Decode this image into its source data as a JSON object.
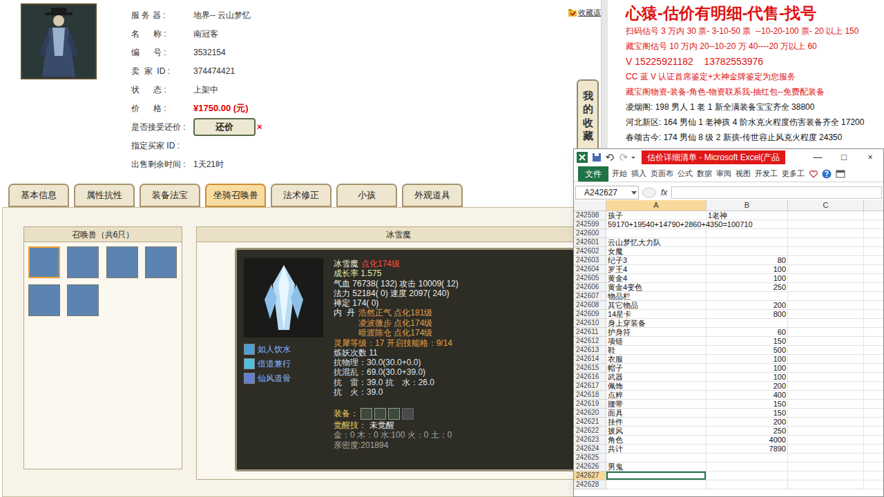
{
  "listing": {
    "favorite_link": "收藏该",
    "side_tab": "我的收藏",
    "fields": [
      {
        "kind": "text",
        "label": "服 务 器 :",
        "value": "地界-- 云山梦忆"
      },
      {
        "kind": "text",
        "label": "名      称 :",
        "value": "南冠客"
      },
      {
        "kind": "text",
        "label": "编      号 :",
        "value": "3532154"
      },
      {
        "kind": "text",
        "label": "卖  家  ID :",
        "value": "374474421"
      },
      {
        "kind": "text",
        "label": "状      态 :",
        "value": "上架中"
      },
      {
        "kind": "price",
        "label": "价      格 :",
        "value": "¥1750.00 (元)"
      },
      {
        "kind": "button",
        "label": "是否接受还价 :",
        "value": "还价",
        "mark": "×"
      },
      {
        "kind": "label",
        "label": "指定买家 ID :"
      },
      {
        "kind": "text",
        "label": "出售剩余时间 :",
        "value": "1天21时"
      }
    ]
  },
  "tabs": [
    {
      "label": "基本信息",
      "selected": false
    },
    {
      "label": "属性抗性",
      "selected": false
    },
    {
      "label": "装备法宝",
      "selected": false
    },
    {
      "label": "坐骑召唤兽",
      "selected": true
    },
    {
      "label": "法术修正",
      "selected": false
    },
    {
      "label": "小孩",
      "selected": false
    },
    {
      "label": "外观道具",
      "selected": false
    }
  ],
  "pets": {
    "title": "召唤兽（共6只）",
    "items": [
      {
        "selected": true
      },
      {
        "selected": false
      },
      {
        "selected": false
      },
      {
        "selected": false
      },
      {
        "selected": false
      },
      {
        "selected": false
      }
    ]
  },
  "pet_detail": {
    "header": "冰雪魔",
    "skills": [
      "如人饮水",
      "倍道兼行",
      "仙风道骨"
    ],
    "lines": [
      [
        {
          "text": "冰雪魔",
          "color": "#f2f2d8"
        },
        {
          "text": "点化174级",
          "color": "#ff5040"
        }
      ],
      [
        {
          "text": "成长率 1.575",
          "color": "#e6eeb0"
        }
      ],
      [
        {
          "text": "气血 76738( 132) 攻击 10009( 12)",
          "color": "#eeeeee"
        }
      ],
      [
        {
          "text": "法力 52184( 0) 速度 2097( 240)",
          "color": "#eeeeee"
        }
      ],
      [
        {
          "text": "禅定 174( 0)",
          "color": "#eeeeee"
        }
      ]
    ],
    "neidan": {
      "label": "内  丹",
      "items": [
        "浩然正气 点化181级",
        "凌波微步 点化174级",
        "暗渡陈仓 点化174级"
      ]
    },
    "lines2": [
      [
        {
          "text": "灵犀等级：17 开启技能格：9/14",
          "color": "#f0a040"
        }
      ],
      [
        {
          "text": "炼妖次数 11",
          "color": "#dde6f0"
        }
      ],
      [
        {
          "text": "抗物理：30.0(30.0+0.0)",
          "color": "#dde6f0"
        }
      ],
      [
        {
          "text": "抗混乱：69.0(30.0+39.0)",
          "color": "#dde6f0"
        }
      ],
      [
        {
          "text": "抗　雷：39.0 抗　水：26.0",
          "color": "#dde6f0"
        }
      ],
      [
        {
          "text": "抗　火：39.0",
          "color": "#dde6f0"
        }
      ]
    ],
    "equip_label": "装备：",
    "equip_slots": [
      {
        "filled": true
      },
      {
        "filled": true
      },
      {
        "filled": true
      },
      {
        "filled": false
      }
    ],
    "awaken": {
      "label": "觉醒技：",
      "value": "未觉醒"
    },
    "lines3": [
      "金：0 木：0 水:100 火：0 土：0",
      "亲密度:201894"
    ]
  },
  "ad": [
    {
      "kind": "title",
      "text": "心猿-估价有明细-代售-找号",
      "color": "#e01010"
    },
    {
      "kind": "line",
      "text": "扫码估号 3 万内 30 票- 3-10-50 票  --10-20-100 票- 20 以上 150",
      "color": "#e01010"
    },
    {
      "kind": "line",
      "text": "藏宝阁估号 10 万内 20--10-20 万 40----20 万以上 60",
      "color": "#e01010"
    },
    {
      "kind": "phone",
      "text": "V 15225921182    13782553976",
      "color": "#e01010"
    },
    {
      "kind": "line",
      "text": "CC 蓝 V 认证首席鉴定+大神金牌鉴定为您服务",
      "color": "#e01010"
    },
    {
      "kind": "line",
      "text": "藏宝阁物资-装备-角色-物资联系我-抽红包--免费配装备",
      "color": "#e01010"
    },
    {
      "kind": "line",
      "text": "凌烟阁: 198 男人 1 老 1 新全满装备宝宝齐全 38800",
      "color": "#111111"
    },
    {
      "kind": "line",
      "text": "河北新区: 164 男仙 1 老神孩 4 阶水克火程度伤害装备齐全 17200",
      "color": "#111111"
    },
    {
      "kind": "line",
      "text": "春颂古今: 174 男仙 8 级 2 新孩-传世容止风克火程度 24350",
      "color": "#111111"
    }
  ],
  "excel": {
    "title": "估价详细清单 - Microsoft Excel(产品",
    "window_buttons": [
      "—",
      "□",
      "×"
    ],
    "ribbon_tabs": [
      {
        "label": "文件",
        "kind": "file"
      },
      {
        "label": "开始",
        "kind": "tab"
      },
      {
        "label": "插入",
        "kind": "tab"
      },
      {
        "label": "页面布",
        "kind": "tab"
      },
      {
        "label": "公式",
        "kind": "tab"
      },
      {
        "label": "数据",
        "kind": "tab"
      },
      {
        "label": "审阅",
        "kind": "tab"
      },
      {
        "label": "视图",
        "kind": "tab"
      },
      {
        "label": "开发工",
        "kind": "tab"
      },
      {
        "label": "更多工",
        "kind": "tab"
      }
    ],
    "name_box": "A242627",
    "fx": "fx",
    "columns": [
      {
        "label": "A",
        "selected": true
      },
      {
        "label": "B",
        "selected": false
      },
      {
        "label": "C",
        "selected": false
      }
    ],
    "rows": [
      {
        "n": "242598",
        "a": "孩子",
        "b": "1老神",
        "selected": false
      },
      {
        "n": "242599",
        "a": "59170+19540+14790+2860+4350=100710",
        "b": "",
        "selected": false
      },
      {
        "n": "242600",
        "a": "",
        "b": "",
        "selected": false
      },
      {
        "n": "242601",
        "a": "云山梦忆大力队",
        "b": "",
        "selected": false
      },
      {
        "n": "242602",
        "a": "女魔",
        "b": "",
        "selected": false
      },
      {
        "n": "242603",
        "a": "纪子3",
        "b": "80",
        "selected": false
      },
      {
        "n": "242604",
        "a": "罗王4",
        "b": "100",
        "selected": false
      },
      {
        "n": "242605",
        "a": "黄金4",
        "b": "100",
        "selected": false
      },
      {
        "n": "242606",
        "a": "黄金4变色",
        "b": "250",
        "selected": false
      },
      {
        "n": "242607",
        "a": "物品栏",
        "b": "",
        "selected": false
      },
      {
        "n": "242608",
        "a": "其它物品",
        "b": "200",
        "selected": false
      },
      {
        "n": "242609",
        "a": "14星卡",
        "b": "800",
        "selected": false
      },
      {
        "n": "242610",
        "a": "身上穿装备",
        "b": "",
        "selected": false
      },
      {
        "n": "242611",
        "a": "护身符",
        "b": "60",
        "selected": false
      },
      {
        "n": "242612",
        "a": "项链",
        "b": "150",
        "selected": false
      },
      {
        "n": "242613",
        "a": "鞋",
        "b": "500",
        "selected": false
      },
      {
        "n": "242614",
        "a": "衣服",
        "b": "100",
        "selected": false
      },
      {
        "n": "242615",
        "a": "帽子",
        "b": "100",
        "selected": false
      },
      {
        "n": "242616",
        "a": "武器",
        "b": "100",
        "selected": false
      },
      {
        "n": "242617",
        "a": "佩饰",
        "b": "200",
        "selected": false
      },
      {
        "n": "242618",
        "a": "点粹",
        "b": "400",
        "selected": false
      },
      {
        "n": "242619",
        "a": "腰带",
        "b": "150",
        "selected": false
      },
      {
        "n": "242620",
        "a": "面具",
        "b": "150",
        "selected": false
      },
      {
        "n": "242621",
        "a": "挂件",
        "b": "200",
        "selected": false
      },
      {
        "n": "242622",
        "a": "披风",
        "b": "250",
        "selected": false
      },
      {
        "n": "242623",
        "a": "角色",
        "b": "4000",
        "selected": false
      },
      {
        "n": "242624",
        "a": "共计",
        "b": "7890",
        "selected": false
      },
      {
        "n": "242625",
        "a": "",
        "b": "",
        "selected": false
      },
      {
        "n": "242626",
        "a": "男鬼",
        "b": "",
        "selected": false
      },
      {
        "n": "242627",
        "a": "",
        "b": "",
        "selected": true
      },
      {
        "n": "242628",
        "a": "",
        "b": "",
        "selected": false
      }
    ]
  }
}
